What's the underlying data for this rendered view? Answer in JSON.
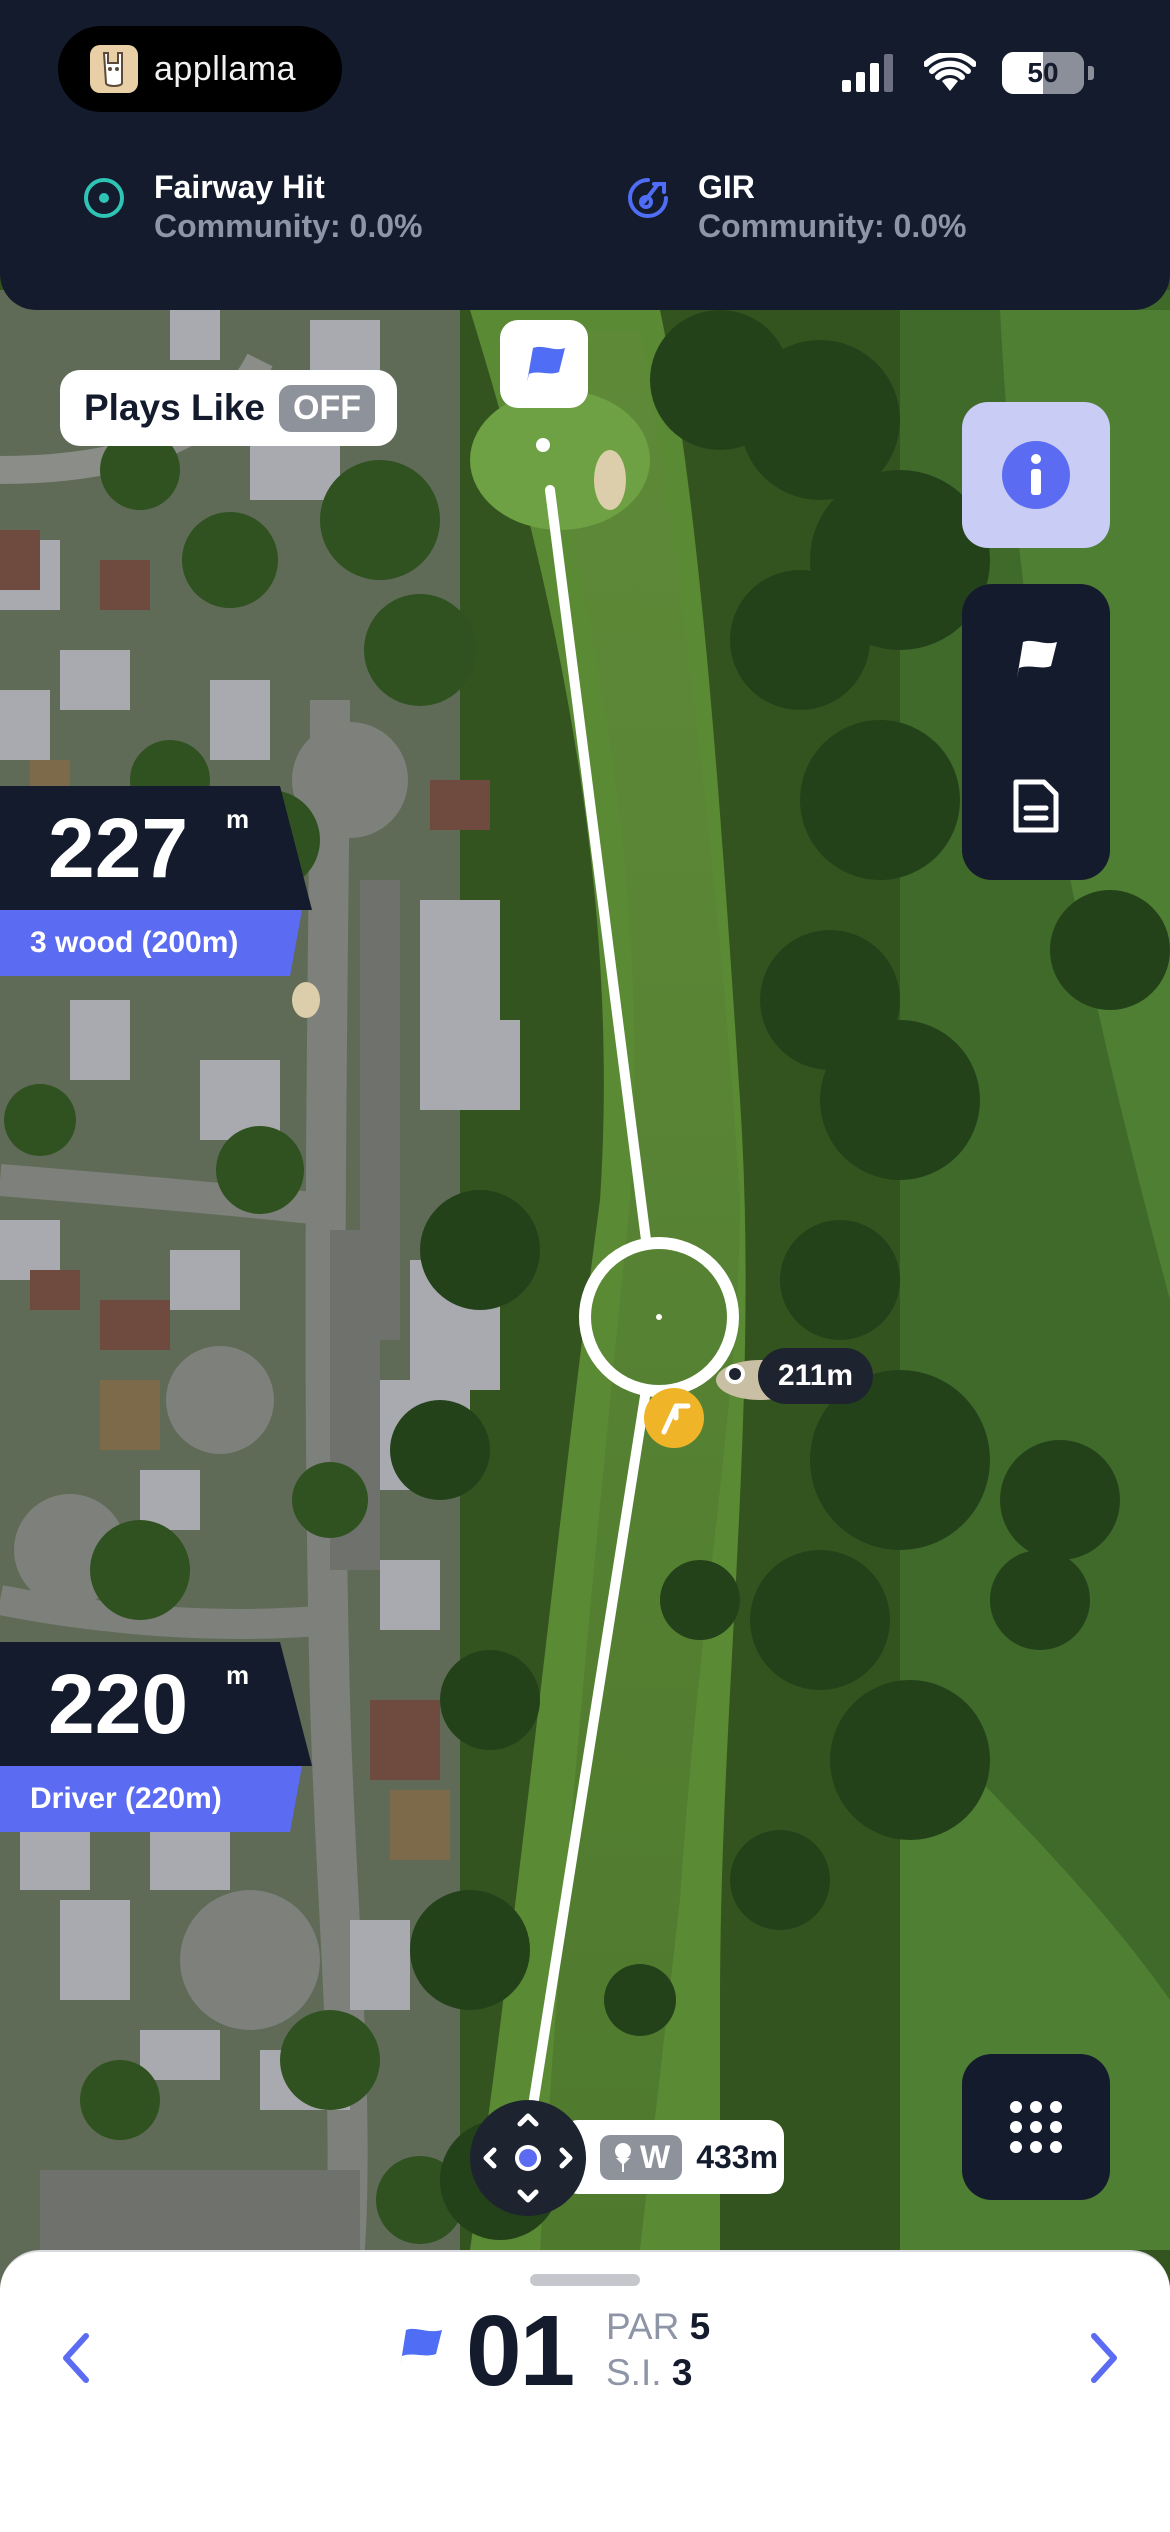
{
  "brand": {
    "name": "appllama"
  },
  "status": {
    "battery": "50"
  },
  "stats": [
    {
      "title": "Fairway Hit",
      "sub": "Community: 0.0%"
    },
    {
      "title": "GIR",
      "sub": "Community: 0.0%"
    }
  ],
  "plays_like": {
    "label": "Plays Like",
    "state": "OFF"
  },
  "distances": [
    {
      "value": "227",
      "unit": "m",
      "club": "3 wood (200m)"
    },
    {
      "value": "220",
      "unit": "m",
      "club": "Driver (220m)"
    }
  ],
  "map": {
    "target_distance": "211m",
    "wind_label": "W",
    "tee_distance": "433m"
  },
  "hole": {
    "number": "01",
    "par_label": "PAR",
    "par": "5",
    "si_label": "S.I.",
    "si": "3"
  },
  "colors": {
    "navy": "#141b2d",
    "accent": "#5b6cf2",
    "info_bg": "#c9ccf4",
    "hazard": "#f0b429"
  },
  "icons": [
    "target-icon",
    "gir-icon",
    "info-icon",
    "flag-icon",
    "scorecard-icon",
    "keypad-icon",
    "tee-icon",
    "chevron-left-icon",
    "chevron-right-icon",
    "move-icon",
    "hazard-icon"
  ]
}
